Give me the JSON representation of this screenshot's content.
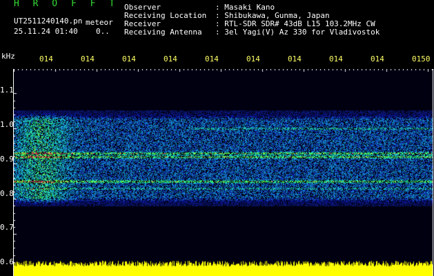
{
  "header": {
    "title": "H R O F F T",
    "filename": "UT2511240140.pn",
    "meteor_label": "meteor",
    "datetime": "25.11.24 01:40",
    "count": "0..",
    "info": [
      {
        "label": "Observer",
        "value": ": Masaki Kano"
      },
      {
        "label": "Receiving Location",
        "value": ": Shibukawa, Gunma, Japan"
      },
      {
        "label": "Receiver",
        "value": ": RTL-SDR SDR# 43dB L15 103.2MHz CW"
      },
      {
        "label": "Receiving Antenna",
        "value": ": 3el Yagi(V) Az 330 for Vladivostok"
      }
    ]
  },
  "axes": {
    "y_unit": "kHz",
    "y_ticks": [
      "1.1",
      "1.0",
      "0.9",
      "0.8",
      "0.7",
      "0.6"
    ],
    "x_ticks": [
      "014",
      "014",
      "014",
      "014",
      "014",
      "014",
      "014",
      "014",
      "014",
      "0150"
    ]
  },
  "spectrogram": {
    "freq_range_khz": [
      0.6,
      1.15
    ],
    "signal_band_khz": [
      0.78,
      1.05
    ],
    "bright_lines_khz": [
      0.85,
      0.92,
      0.93
    ],
    "colors": {
      "background": "#000010",
      "low": "#0a1a80",
      "mid": "#20c8d0",
      "high": "#30ff40",
      "peak": "#ff3060",
      "audio_level": "#ffff00"
    }
  }
}
